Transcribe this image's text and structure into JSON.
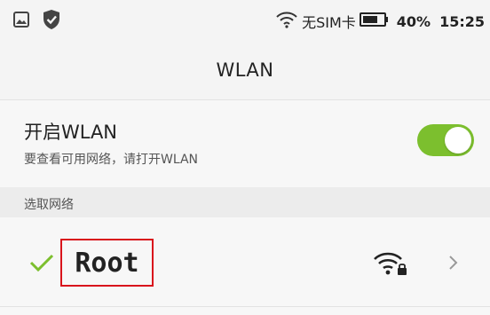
{
  "status_bar": {
    "icons_left": [
      "image-icon",
      "shield-check-icon"
    ],
    "sim_text": "无SIM卡",
    "battery_percent": "40%",
    "time": "15:25"
  },
  "header": {
    "title": "WLAN"
  },
  "wlan_toggle": {
    "label": "开启WLAN",
    "description": "要查看可用网络，请打开WLAN",
    "enabled": true,
    "accent_color": "#7cbf2e"
  },
  "section": {
    "label": "选取网络"
  },
  "networks": [
    {
      "ssid": "Root",
      "connected": true,
      "secured": true
    }
  ],
  "highlight_color": "#d9141c"
}
